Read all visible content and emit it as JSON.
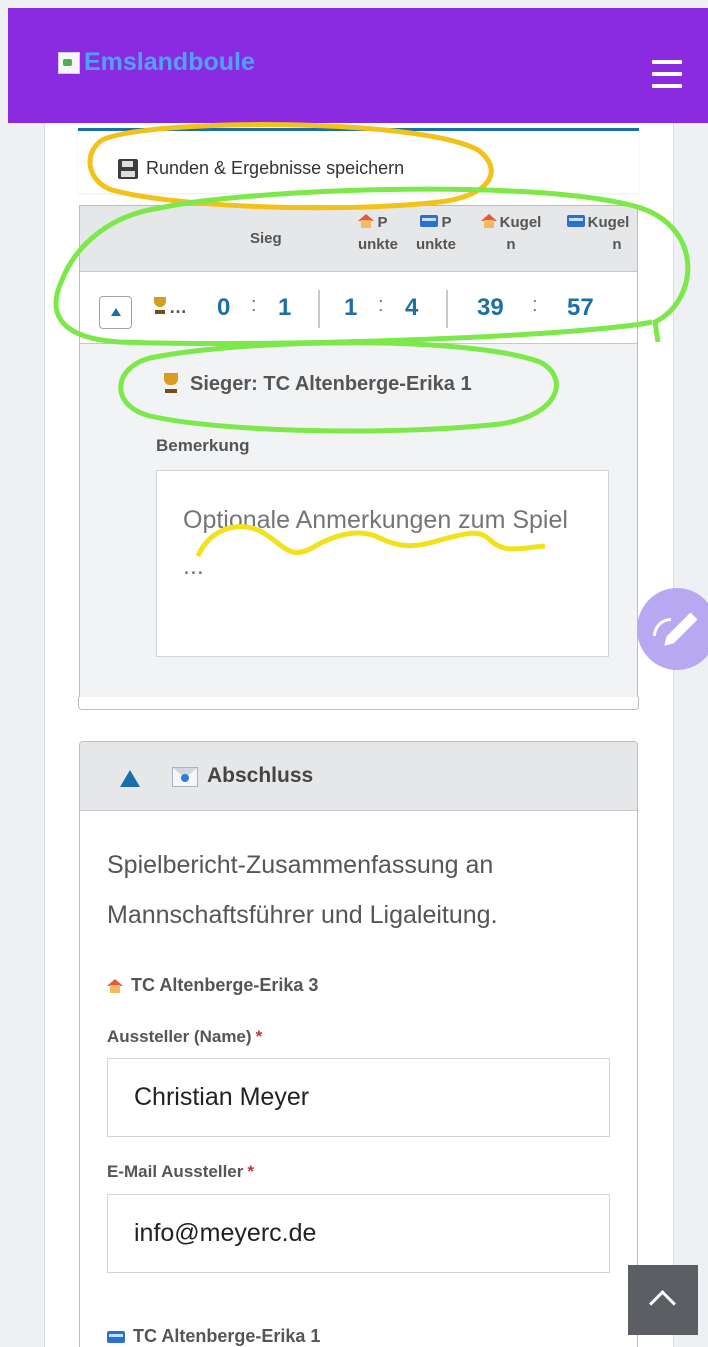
{
  "app": {
    "brand": "Emslandboule"
  },
  "save_row": {
    "label": "Runden & Ergebnisse speichern"
  },
  "round": {
    "columns": {
      "win": "Sieg",
      "home_points_a": "P",
      "home_points_b": "unkte",
      "away_points_a": "P",
      "away_points_b": "unkte",
      "home_balls_a": "Kugel",
      "home_balls_b": "n",
      "away_balls_a": "Kugel",
      "away_balls_b": "n"
    },
    "scores": {
      "trophy_ellipsis": "…",
      "win_home": "0",
      "win_away": "1",
      "points_home": "1",
      "points_away": "4",
      "balls_home": "39",
      "balls_away": "57",
      "colon": ":"
    },
    "winner": "Sieger: TC Altenberge-Erika 1",
    "remark_label": "Bemerkung",
    "remark_placeholder": "Optionale Anmerkungen zum Spiel ..."
  },
  "abschluss": {
    "title": "Abschluss",
    "description": "Spielbericht-Zusammenfassung an Mannschaftsführer und Ligaleitung.",
    "home_team": "TC Altenberge-Erika 3",
    "issuer_label": "Aussteller (Name)",
    "issuer_value": "Christian Meyer",
    "email_label": "E-Mail Aussteller",
    "email_value": "info@meyerc.de",
    "away_team": "TC Altenberge-Erika 1",
    "required_mark": "*"
  },
  "colors": {
    "topbar": "#8a2be2",
    "brand_text": "#4fa3ff",
    "accent": "#1b6fa8",
    "annotation_green": "#7ce84a",
    "annotation_yellow": "#f2c21b"
  },
  "icons": [
    "menu-icon",
    "floppy-icon",
    "home-icon",
    "bus-icon",
    "trophy-icon",
    "envelope-icon",
    "edit-icon",
    "chevron-up-icon"
  ]
}
